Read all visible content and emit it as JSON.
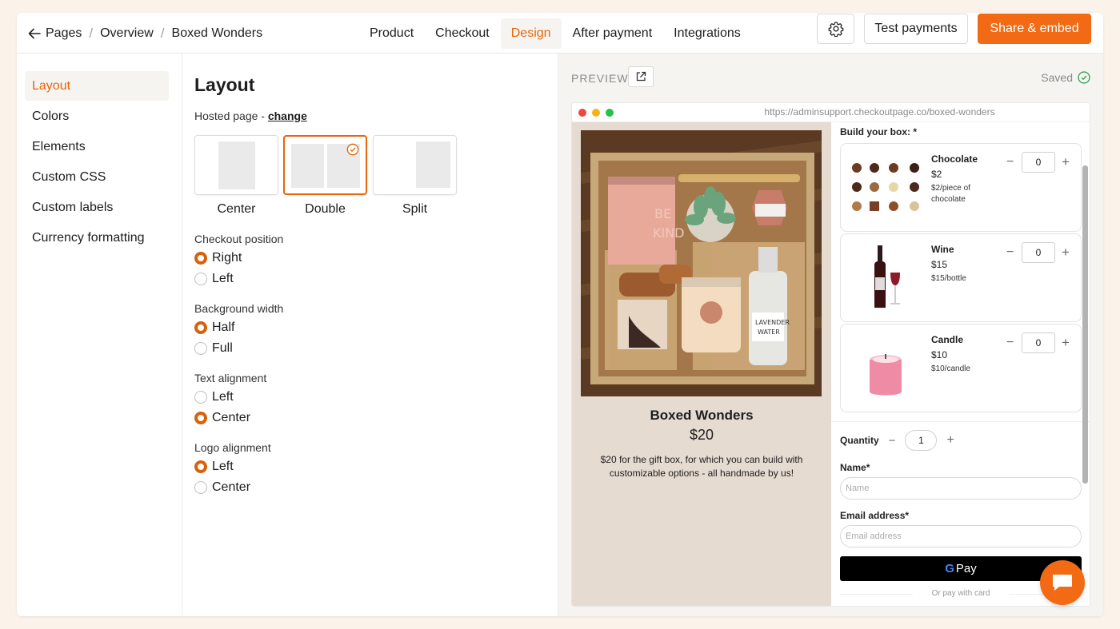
{
  "breadcrumb": {
    "items": [
      "Pages",
      "Overview",
      "Boxed Wonders"
    ]
  },
  "nav": {
    "tabs": [
      {
        "label": "Product",
        "active": false
      },
      {
        "label": "Checkout",
        "active": false
      },
      {
        "label": "Design",
        "active": true
      },
      {
        "label": "After payment",
        "active": false
      },
      {
        "label": "Integrations",
        "active": false
      }
    ]
  },
  "header": {
    "test_label": "Test payments",
    "share_label": "Share & embed",
    "accent": "#f26a13"
  },
  "sidebar": {
    "items": [
      "Layout",
      "Colors",
      "Elements",
      "Custom CSS",
      "Custom labels",
      "Currency formatting"
    ],
    "active": "Layout"
  },
  "settings": {
    "title": "Layout",
    "hosted_prefix": "Hosted page - ",
    "hosted_link": "change",
    "layout_options": [
      {
        "label": "Center",
        "selected": false
      },
      {
        "label": "Double",
        "selected": true
      },
      {
        "label": "Split",
        "selected": false
      }
    ],
    "groups": [
      {
        "title": "Checkout position",
        "options": [
          "Right",
          "Left"
        ],
        "selected": "Right"
      },
      {
        "title": "Background width",
        "options": [
          "Half",
          "Full"
        ],
        "selected": "Half"
      },
      {
        "title": "Text alignment",
        "options": [
          "Left",
          "Center"
        ],
        "selected": "Center"
      },
      {
        "title": "Logo alignment",
        "options": [
          "Left",
          "Center"
        ],
        "selected": "Left"
      }
    ]
  },
  "preview": {
    "label": "PREVIEW",
    "saved": "Saved",
    "url": "https://adminsupport.checkoutpage.co/boxed-wonders",
    "product": {
      "title": "Boxed Wonders",
      "price": "$20",
      "description": "$20 for the gift box, for which you can build with customizable options - all handmade by us!"
    },
    "build_label": "Build your box:",
    "items": [
      {
        "name": "Chocolate",
        "price": "$2",
        "unit": "$2/piece of chocolate",
        "qty": "0"
      },
      {
        "name": "Wine",
        "price": "$15",
        "unit": "$15/bottle",
        "qty": "0"
      },
      {
        "name": "Candle",
        "price": "$10",
        "unit": "$10/candle",
        "qty": "0"
      }
    ],
    "quantity_label": "Quantity",
    "quantity": "1",
    "name_label": "Name",
    "name_placeholder": "Name",
    "email_label": "Email address",
    "email_placeholder": "Email address",
    "gpay_label": "Pay",
    "or_pay": "Or pay with card"
  }
}
